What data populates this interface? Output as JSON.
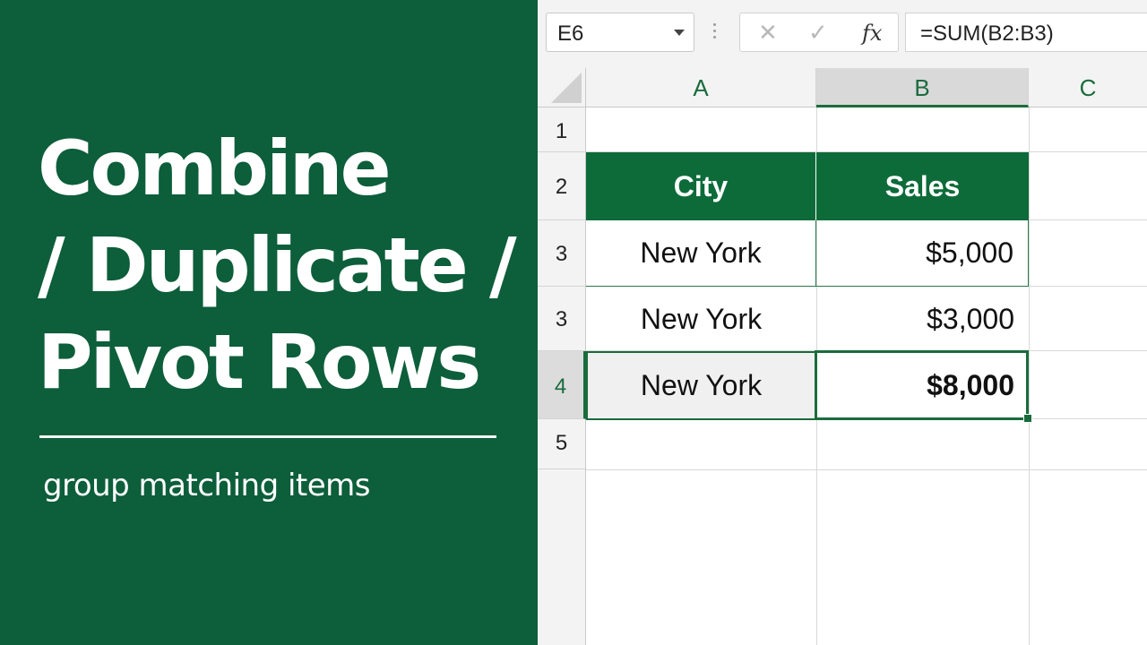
{
  "left_panel": {
    "title_lines": [
      "Combine",
      "/ Duplicate /",
      "Pivot Rows"
    ],
    "subtitle": "group matching items",
    "background_color": "#0d5e3a"
  },
  "formula_bar": {
    "name_box": "E6",
    "cancel_icon": "close-icon",
    "enter_icon": "check-icon",
    "function_label": "fx",
    "formula": "=SUM(B2:B3)"
  },
  "columns": [
    "A",
    "B",
    "C"
  ],
  "selected_column": "B",
  "rows": [
    {
      "label": "1",
      "cells": [
        "",
        ""
      ]
    },
    {
      "label": "2",
      "cells": [
        "City",
        "Sales"
      ]
    },
    {
      "label": "3",
      "cells": [
        "New York",
        "$5,000"
      ]
    },
    {
      "label": "3",
      "cells": [
        "New York",
        "$3,000"
      ]
    },
    {
      "label": "4",
      "cells": [
        "New York",
        "$8,000"
      ]
    },
    {
      "label": "5",
      "cells": [
        "",
        ""
      ]
    }
  ],
  "selected_row": "4",
  "accent_color": "#1a6b3c"
}
